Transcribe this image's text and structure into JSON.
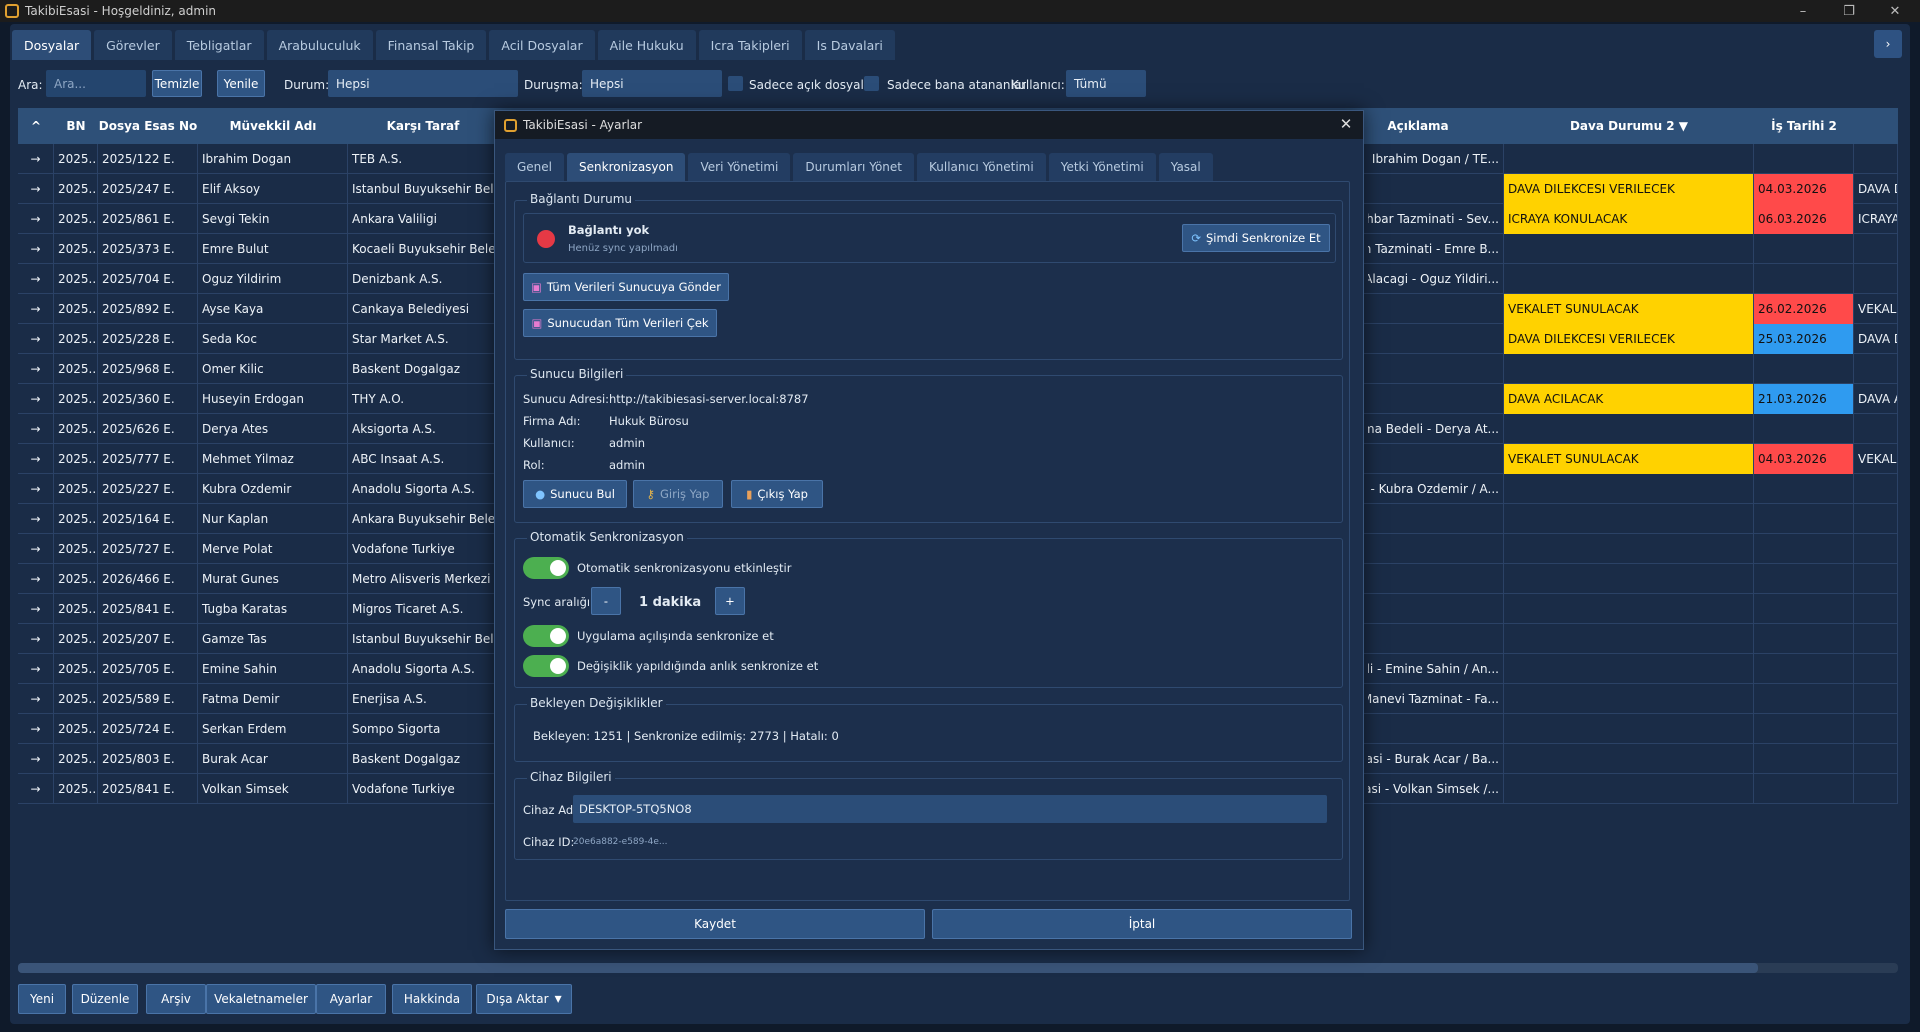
{
  "window": {
    "title": "TakibiEsasi - Hoşgeldiniz, admin",
    "minimize": "–",
    "maximize": "❐",
    "close": "✕"
  },
  "tabs": [
    "Dosyalar",
    "Görevler",
    "Tebligatlar",
    "Arabuluculuk",
    "Finansal Takip",
    "Acil Dosyalar",
    "Aile Hukuku",
    "Icra Takipleri",
    "Is Davalari"
  ],
  "nav_arrow": "›",
  "filters": {
    "search_label": "Ara:",
    "search_placeholder": "Ara...",
    "clear_button": "Temizle",
    "refresh_button": "Yenile",
    "status_label": "Durum:",
    "status_value": "Hepsi",
    "hearing_label": "Duruşma:",
    "hearing_value": "Hepsi",
    "only_open_label": "Sadece açık dosyalar",
    "only_mine_label": "Sadece bana atananlar",
    "user_label": "Kullanıcı:",
    "user_value": "Tümü"
  },
  "table": {
    "sort_arrow": "^",
    "headers": {
      "bn": "BN",
      "esas": "Dosya Esas No",
      "muvekkil": "Müvekkil Adı",
      "karsi": "Karşı Taraf",
      "aciklama": "Açıklama",
      "dava_durumu": "Dava Durumu 2 ▼",
      "is_tarihi": "İş Tarihi 2"
    },
    "rows": [
      {
        "arrow": "→",
        "bn": "2025...",
        "esas": "2025/122 E.",
        "muvekkil": "Ibrahim Dogan",
        "karsi": "TEB A.S.",
        "aciklama": "i - Ibrahim Dogan / TE...",
        "durum": "",
        "tarih": "",
        "tarih_color": "",
        "extra": ""
      },
      {
        "arrow": "→",
        "bn": "2025...",
        "esas": "2025/247 E.",
        "muvekkil": "Elif Aksoy",
        "karsi": "Istanbul Buyuksehir Bele...",
        "aciklama": "",
        "durum": "DAVA DILEKCESI VERILECEK",
        "tarih": "04.03.2026",
        "tarih_color": "red",
        "extra": "DAVA DIL"
      },
      {
        "arrow": "→",
        "bn": "2025...",
        "esas": "2025/861 E.",
        "muvekkil": "Sevgi Tekin",
        "karsi": "Ankara Valiligi",
        "aciklama": "Ihbar Tazminati - Sev...",
        "durum": "ICRAYA KONULACAK",
        "tarih": "06.03.2026",
        "tarih_color": "red",
        "extra": "ICRAYA K"
      },
      {
        "arrow": "→",
        "bn": "2025...",
        "esas": "2025/373 E.",
        "muvekkil": "Emre Bulut",
        "karsi": "Kocaeli Buyuksehir Beledi...",
        "aciklama": "sih Tazminati - Emre B...",
        "durum": "",
        "tarih": "",
        "tarih_color": "",
        "extra": ""
      },
      {
        "arrow": "→",
        "bn": "2025...",
        "esas": "2025/704 E.",
        "muvekkil": "Oguz Yildirim",
        "karsi": "Denizbank A.S.",
        "aciklama": "t Alacagi - Oguz Yildiri...",
        "durum": "",
        "tarih": "",
        "tarih_color": "",
        "extra": ""
      },
      {
        "arrow": "→",
        "bn": "2025...",
        "esas": "2025/892 E.",
        "muvekkil": "Ayse Kaya",
        "karsi": "Cankaya Belediyesi",
        "aciklama": "",
        "durum": "VEKALET SUNULACAK",
        "tarih": "26.02.2026",
        "tarih_color": "red",
        "extra": "VEKALET"
      },
      {
        "arrow": "→",
        "bn": "2025...",
        "esas": "2025/228 E.",
        "muvekkil": "Seda Koc",
        "karsi": "Star Market A.S.",
        "aciklama": "",
        "durum": "DAVA DILEKCESI VERILECEK",
        "tarih": "25.03.2026",
        "tarih_color": "blue",
        "extra": "DAVA DIL"
      },
      {
        "arrow": "→",
        "bn": "2025...",
        "esas": "2025/968 E.",
        "muvekkil": "Omer Kilic",
        "karsi": "Baskent Dogalgaz",
        "aciklama": "",
        "durum": "",
        "tarih": "",
        "tarih_color": "",
        "extra": ""
      },
      {
        "arrow": "→",
        "bn": "2025...",
        "esas": "2025/360 E.",
        "muvekkil": "Huseyin Erdogan",
        "karsi": "THY A.O.",
        "aciklama": "",
        "durum": "DAVA ACILACAK",
        "tarih": "21.03.2026",
        "tarih_color": "blue",
        "extra": "DAVA AC"
      },
      {
        "arrow": "→",
        "bn": "2025...",
        "esas": "2025/626 E.",
        "muvekkil": "Derya Ates",
        "karsi": "Aksigorta A.S.",
        "aciklama": "rirma Bedeli - Derya At...",
        "durum": "",
        "tarih": "",
        "tarih_color": "",
        "extra": ""
      },
      {
        "arrow": "→",
        "bn": "2025...",
        "esas": "2025/777 E.",
        "muvekkil": "Mehmet Yilmaz",
        "karsi": "ABC Insaat A.S.",
        "aciklama": "",
        "durum": "VEKALET SUNULACAK",
        "tarih": "04.03.2026",
        "tarih_color": "red",
        "extra": "VEKALET"
      },
      {
        "arrow": "→",
        "bn": "2025...",
        "esas": "2025/227 E.",
        "muvekkil": "Kubra Ozdemir",
        "karsi": "Anadolu Sigorta A.S.",
        "aciklama": "i - Kubra Ozdemir / A...",
        "durum": "",
        "tarih": "",
        "tarih_color": "",
        "extra": ""
      },
      {
        "arrow": "→",
        "bn": "2025...",
        "esas": "2025/164 E.",
        "muvekkil": "Nur Kaplan",
        "karsi": "Ankara Buyuksehir Beledi...",
        "aciklama": "",
        "durum": "",
        "tarih": "",
        "tarih_color": "",
        "extra": ""
      },
      {
        "arrow": "→",
        "bn": "2025...",
        "esas": "2025/727 E.",
        "muvekkil": "Merve Polat",
        "karsi": "Vodafone Turkiye",
        "aciklama": "",
        "durum": "",
        "tarih": "",
        "tarih_color": "",
        "extra": ""
      },
      {
        "arrow": "→",
        "bn": "2025...",
        "esas": "2026/466 E.",
        "muvekkil": "Murat Gunes",
        "karsi": "Metro Alisveris Merkezi",
        "aciklama": "",
        "durum": "",
        "tarih": "",
        "tarih_color": "",
        "extra": ""
      },
      {
        "arrow": "→",
        "bn": "2025...",
        "esas": "2025/841 E.",
        "muvekkil": "Tugba Karatas",
        "karsi": "Migros Ticaret A.S.",
        "aciklama": "",
        "durum": "",
        "tarih": "",
        "tarih_color": "",
        "extra": ""
      },
      {
        "arrow": "→",
        "bn": "2025...",
        "esas": "2025/207 E.",
        "muvekkil": "Gamze Tas",
        "karsi": "Istanbul Buyuksehir Bele...",
        "aciklama": "",
        "durum": "",
        "tarih": "",
        "tarih_color": "",
        "extra": ""
      },
      {
        "arrow": "→",
        "bn": "2025...",
        "esas": "2025/705 E.",
        "muvekkil": "Emine Sahin",
        "karsi": "Anadolu Sigorta A.S.",
        "aciklama": "tali - Emine Sahin / An...",
        "durum": "",
        "tarih": "",
        "tarih_color": "",
        "extra": ""
      },
      {
        "arrow": "→",
        "bn": "2025...",
        "esas": "2025/589 E.",
        "muvekkil": "Fatma Demir",
        "karsi": "Enerjisa A.S.",
        "aciklama": "Manevi Tazminat - Fa...",
        "durum": "",
        "tarih": "",
        "tarih_color": "",
        "extra": ""
      },
      {
        "arrow": "→",
        "bn": "2025...",
        "esas": "2025/724 E.",
        "muvekkil": "Serkan Erdem",
        "karsi": "Sompo Sigorta",
        "aciklama": "",
        "durum": "",
        "tarih": "",
        "tarih_color": "",
        "extra": ""
      },
      {
        "arrow": "→",
        "bn": "2025...",
        "esas": "2025/803 E.",
        "muvekkil": "Burak Acar",
        "karsi": "Baskent Dogalgaz",
        "aciklama": "avasi - Burak Acar / Ba...",
        "durum": "",
        "tarih": "",
        "tarih_color": "",
        "extra": ""
      },
      {
        "arrow": "→",
        "bn": "2025...",
        "esas": "2025/841 E.",
        "muvekkil": "Volkan Simsek",
        "karsi": "Vodafone Turkiye",
        "aciklama": "avasi - Volkan Simsek /...",
        "durum": "",
        "tarih": "",
        "tarih_color": "",
        "extra": ""
      }
    ]
  },
  "bottom_buttons": [
    "Yeni",
    "Düzenle",
    "Arşiv",
    "Vekaletnameler",
    "Ayarlar",
    "Hakkinda",
    "Dışa Aktar"
  ],
  "export_dropdown_arrow": "▾",
  "dialog": {
    "title": "TakibiEsasi - Ayarlar",
    "close": "✕",
    "tabs": [
      "Genel",
      "Senkronizasyon",
      "Veri Yönetimi",
      "Durumları Yönet",
      "Kullanıcı Yönetimi",
      "Yetki Yönetimi",
      "Yasal"
    ],
    "connection": {
      "group_title": "Bağlantı Durumu",
      "status": "Bağlantı yok",
      "sub": "Henüz sync yapılmadı",
      "sync_now": "Şimdi Senkronize Et",
      "send_all": "Tüm Verileri Sunucuya Gönder",
      "pull_all": "Sunucudan Tüm Verileri Çek",
      "status_color": "#e53945"
    },
    "server": {
      "group_title": "Sunucu Bilgileri",
      "address_label": "Sunucu Adresi:",
      "address": "http://takibiesasi-server.local:8787",
      "firm_label": "Firma Adı:",
      "firm": "Hukuk Bürosu",
      "user_label": "Kullanıcı:",
      "user": "admin",
      "role_label": "Rol:",
      "role": "admin",
      "find_button": "Sunucu Bul",
      "login_button": "Giriş Yap",
      "logout_button": "Çıkış Yap"
    },
    "auto_sync": {
      "group_title": "Otomatik Senkronizasyon",
      "enable_label": "Otomatik senkronizasyonu etkinleştir",
      "interval_label": "Sync aralığı:",
      "minus": "-",
      "plus": "+",
      "interval_value": "1 dakika",
      "on_open_label": "Uygulama açılışında senkronize et",
      "on_change_label": "Değişiklik yapıldığında anlık senkronize et",
      "toggle_color": "#4caf50"
    },
    "pending": {
      "group_title": "Bekleyen Değişiklikler",
      "text": "Bekleyen: 1251 | Senkronize edilmiş: 2773 | Hatalı: 0"
    },
    "device": {
      "group_title": "Cihaz Bilgileri",
      "name_label": "Cihaz Adı:",
      "name": "DESKTOP-5TQ5NO8",
      "id_label": "Cihaz ID:",
      "id": "20e6a882-e589-4e..."
    },
    "save_button": "Kaydet",
    "cancel_button": "İptal"
  },
  "colors": {
    "status_yellow": "#ffd200",
    "date_red": "#ff4a4a",
    "date_blue": "#2f9bf0",
    "accent": "#2f5584"
  }
}
